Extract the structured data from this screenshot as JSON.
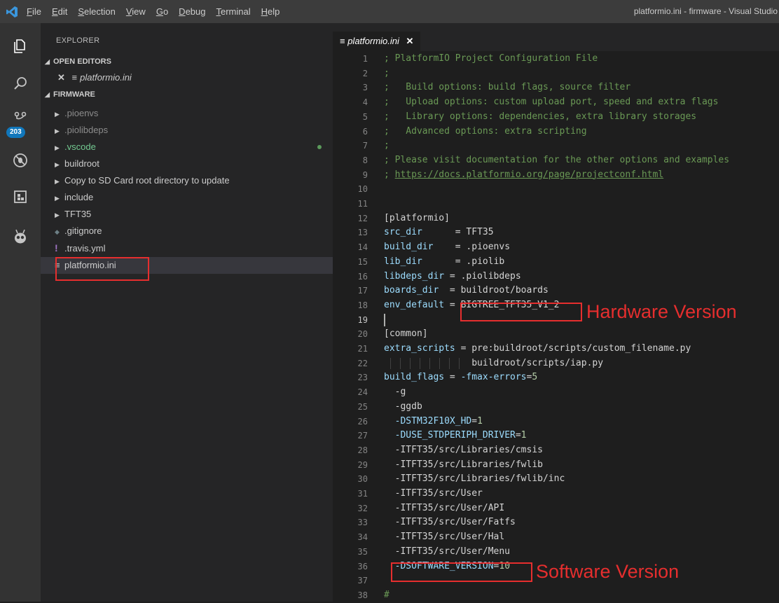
{
  "titlebar": {
    "menu": [
      {
        "acc": "F",
        "rest": "ile"
      },
      {
        "acc": "E",
        "rest": "dit"
      },
      {
        "acc": "S",
        "rest": "election"
      },
      {
        "acc": "V",
        "rest": "iew"
      },
      {
        "acc": "G",
        "rest": "o"
      },
      {
        "acc": "D",
        "rest": "ebug"
      },
      {
        "acc": "T",
        "rest": "erminal"
      },
      {
        "acc": "H",
        "rest": "elp"
      }
    ],
    "window_title": "platformio.ini - firmware - Visual Studio"
  },
  "activitybar": {
    "icons": [
      "explorer-icon",
      "search-icon",
      "source-control-icon",
      "debug-icon",
      "extensions-icon",
      "platformio-icon"
    ],
    "scm_badge": "203"
  },
  "sidebar": {
    "title": "EXPLORER",
    "open_editors_header": "OPEN EDITORS",
    "open_editor_file": "platformio.ini",
    "folder_header": "FIRMWARE",
    "items": [
      {
        "label": ".pioenvs",
        "type": "folder",
        "style": "dim"
      },
      {
        "label": ".piolibdeps",
        "type": "folder",
        "style": "dim"
      },
      {
        "label": ".vscode",
        "type": "folder",
        "style": "green"
      },
      {
        "label": "buildroot",
        "type": "folder",
        "style": "normal"
      },
      {
        "label": "Copy to SD Card root directory to update",
        "type": "folder",
        "style": "normal"
      },
      {
        "label": "include",
        "type": "folder",
        "style": "normal"
      },
      {
        "label": "TFT35",
        "type": "folder",
        "style": "normal"
      },
      {
        "label": ".gitignore",
        "type": "file",
        "style": "normal"
      },
      {
        "label": ".travis.yml",
        "type": "file",
        "style": "normal"
      },
      {
        "label": "platformio.ini",
        "type": "file",
        "style": "selected"
      }
    ]
  },
  "editor": {
    "tab_label": "platformio.ini",
    "current_line": 19,
    "lines": [
      [
        [
          "c-comment",
          "; PlatformIO Project Configuration File"
        ]
      ],
      [
        [
          "c-comment",
          ";"
        ]
      ],
      [
        [
          "c-comment",
          ";   Build options: build flags, source filter"
        ]
      ],
      [
        [
          "c-comment",
          ";   Upload options: custom upload port, speed and extra flags"
        ]
      ],
      [
        [
          "c-comment",
          ";   Library options: dependencies, extra library storages"
        ]
      ],
      [
        [
          "c-comment",
          ";   Advanced options: extra scripting"
        ]
      ],
      [
        [
          "c-comment",
          ";"
        ]
      ],
      [
        [
          "c-comment",
          "; Please visit documentation for the other options and examples"
        ]
      ],
      [
        [
          "c-comment",
          "; "
        ],
        [
          "c-link",
          "https://docs.platformio.org/page/projectconf.html"
        ]
      ],
      [],
      [],
      [
        [
          "c-sec",
          "[platformio]"
        ]
      ],
      [
        [
          "c-key",
          "src_dir"
        ],
        [
          "c-val",
          "      = TFT35"
        ]
      ],
      [
        [
          "c-key",
          "build_dir"
        ],
        [
          "c-val",
          "    = .pioenvs"
        ]
      ],
      [
        [
          "c-key",
          "lib_dir"
        ],
        [
          "c-val",
          "      = .piolib"
        ]
      ],
      [
        [
          "c-key",
          "libdeps_dir"
        ],
        [
          "c-val",
          " = .piolibdeps"
        ]
      ],
      [
        [
          "c-key",
          "boards_dir"
        ],
        [
          "c-val",
          "  = buildroot/boards"
        ]
      ],
      [
        [
          "c-key",
          "env_default"
        ],
        [
          "c-val",
          " = BIGTREE_TFT35_V1_2"
        ]
      ],
      [],
      [
        [
          "c-sec",
          "[common]"
        ]
      ],
      [
        [
          "c-key",
          "extra_scripts"
        ],
        [
          "c-val",
          " = pre:buildroot/scripts/custom_filename.py"
        ]
      ],
      [
        [
          "c-val",
          "                buildroot/scripts/iap.py"
        ]
      ],
      [
        [
          "c-key",
          "build_flags"
        ],
        [
          "c-val",
          " = "
        ],
        [
          "c-flag",
          "-fmax-errors"
        ],
        [
          "c-val",
          "="
        ],
        [
          "c-num",
          "5"
        ]
      ],
      [
        [
          "c-val",
          "  -g"
        ]
      ],
      [
        [
          "c-val",
          "  -ggdb"
        ]
      ],
      [
        [
          "c-val",
          "  "
        ],
        [
          "c-flag",
          "-DSTM32F10X_HD"
        ],
        [
          "c-val",
          "="
        ],
        [
          "c-num",
          "1"
        ]
      ],
      [
        [
          "c-val",
          "  "
        ],
        [
          "c-flag",
          "-DUSE_STDPERIPH_DRIVER"
        ],
        [
          "c-val",
          "="
        ],
        [
          "c-num",
          "1"
        ]
      ],
      [
        [
          "c-val",
          "  -ITFT35/src/Libraries/cmsis"
        ]
      ],
      [
        [
          "c-val",
          "  -ITFT35/src/Libraries/fwlib"
        ]
      ],
      [
        [
          "c-val",
          "  -ITFT35/src/Libraries/fwlib/inc"
        ]
      ],
      [
        [
          "c-val",
          "  -ITFT35/src/User"
        ]
      ],
      [
        [
          "c-val",
          "  -ITFT35/src/User/API"
        ]
      ],
      [
        [
          "c-val",
          "  -ITFT35/src/User/Fatfs"
        ]
      ],
      [
        [
          "c-val",
          "  -ITFT35/src/User/Hal"
        ]
      ],
      [
        [
          "c-val",
          "  -ITFT35/src/User/Menu"
        ]
      ],
      [
        [
          "c-val",
          "  "
        ],
        [
          "c-flag",
          "-DSOFTWARE_VERSION"
        ],
        [
          "c-val",
          "="
        ],
        [
          "c-num",
          "10"
        ]
      ],
      [],
      [
        [
          "c-comment",
          "#"
        ]
      ]
    ]
  },
  "annotations": {
    "hardware_label": "Hardware Version",
    "software_label": "Software Version",
    "color": "#e62e2e"
  }
}
